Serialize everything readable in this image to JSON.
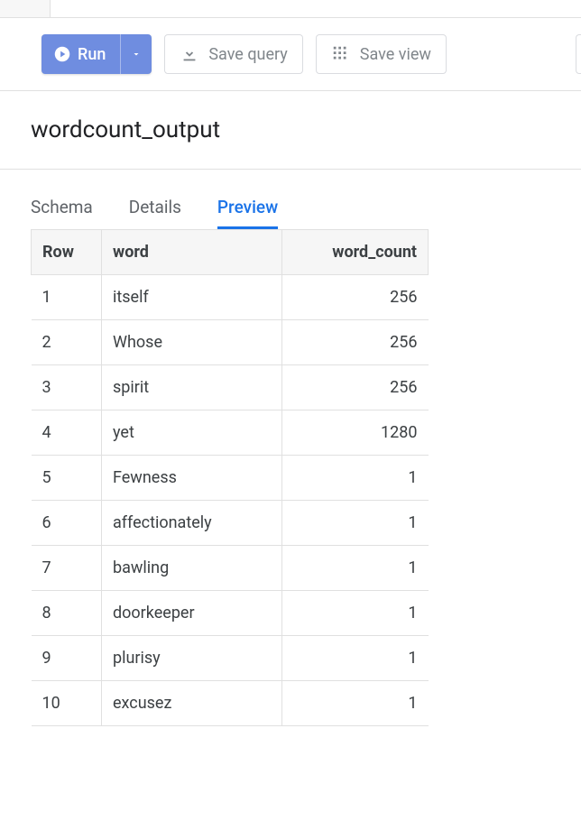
{
  "toolbar": {
    "run_label": "Run",
    "save_query_label": "Save query",
    "save_view_label": "Save view"
  },
  "title": "wordcount_output",
  "tabs": {
    "schema": "Schema",
    "details": "Details",
    "preview": "Preview",
    "active": "preview"
  },
  "table": {
    "headers": {
      "row": "Row",
      "word": "word",
      "word_count": "word_count"
    },
    "rows": [
      {
        "n": "1",
        "word": "itself",
        "count": "256"
      },
      {
        "n": "2",
        "word": "Whose",
        "count": "256"
      },
      {
        "n": "3",
        "word": "spirit",
        "count": "256"
      },
      {
        "n": "4",
        "word": "yet",
        "count": "1280"
      },
      {
        "n": "5",
        "word": "Fewness",
        "count": "1"
      },
      {
        "n": "6",
        "word": "affectionately",
        "count": "1"
      },
      {
        "n": "7",
        "word": "bawling",
        "count": "1"
      },
      {
        "n": "8",
        "word": "doorkeeper",
        "count": "1"
      },
      {
        "n": "9",
        "word": "plurisy",
        "count": "1"
      },
      {
        "n": "10",
        "word": "excusez",
        "count": "1"
      }
    ]
  }
}
